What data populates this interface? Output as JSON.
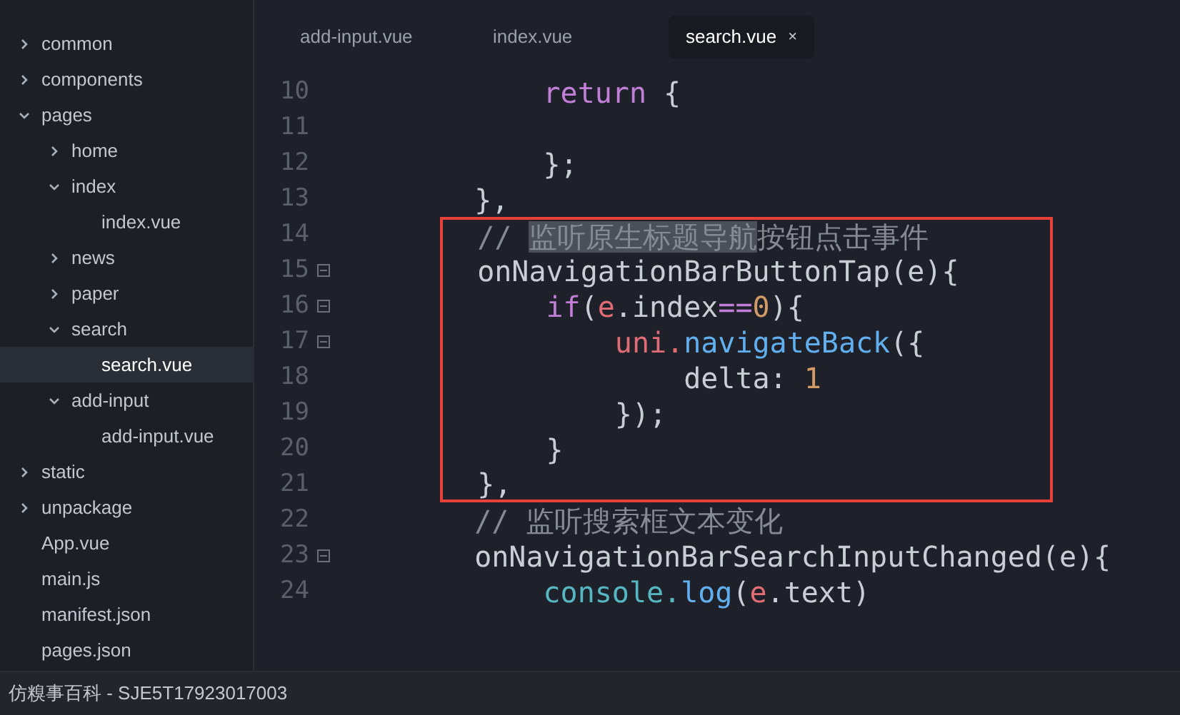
{
  "sidebar": {
    "tree": [
      {
        "label": "common",
        "kind": "folder",
        "expanded": false
      },
      {
        "label": "components",
        "kind": "folder",
        "expanded": false
      },
      {
        "label": "pages",
        "kind": "folder",
        "expanded": true,
        "children": [
          {
            "label": "home",
            "kind": "folder",
            "expanded": false
          },
          {
            "label": "index",
            "kind": "folder",
            "expanded": true,
            "children": [
              {
                "label": "index.vue",
                "kind": "file",
                "selected": false
              }
            ]
          },
          {
            "label": "news",
            "kind": "folder",
            "expanded": false
          },
          {
            "label": "paper",
            "kind": "folder",
            "expanded": false
          },
          {
            "label": "search",
            "kind": "folder",
            "expanded": true,
            "children": [
              {
                "label": "search.vue",
                "kind": "file",
                "selected": true
              }
            ]
          },
          {
            "label": "add-input",
            "kind": "folder",
            "expanded": true,
            "children": [
              {
                "label": "add-input.vue",
                "kind": "file",
                "selected": false
              }
            ]
          }
        ]
      },
      {
        "label": "static",
        "kind": "folder",
        "expanded": false
      },
      {
        "label": "unpackage",
        "kind": "folder",
        "expanded": false
      },
      {
        "label": "App.vue",
        "kind": "file",
        "selected": false
      },
      {
        "label": "main.js",
        "kind": "file",
        "selected": false
      },
      {
        "label": "manifest.json",
        "kind": "file",
        "selected": false
      },
      {
        "label": "pages.json",
        "kind": "file",
        "selected": false
      }
    ]
  },
  "tabs": [
    {
      "label": "add-input.vue",
      "selected": false
    },
    {
      "label": "index.vue",
      "selected": false
    },
    {
      "label": "search.vue",
      "selected": true,
      "close": "×"
    }
  ],
  "editor": {
    "lines": [
      {
        "number": "10",
        "foldable": false,
        "boxed": false,
        "tokens": [
          {
            "text": "      return",
            "kind": "keyword"
          },
          {
            "text": " {",
            "kind": "plain"
          }
        ]
      },
      {
        "number": "11",
        "foldable": false
      },
      {
        "number": "12",
        "foldable": false,
        "boxed": false,
        "tokens": [
          {
            "text": "      };",
            "kind": "plain"
          }
        ]
      },
      {
        "number": "13",
        "foldable": false,
        "boxed": false,
        "tokens": [
          {
            "text": "  },",
            "kind": "plain"
          }
        ]
      },
      {
        "number": "14",
        "foldable": false,
        "boxed": true,
        "tokens": [
          {
            "text": "  // ",
            "kind": "comment"
          },
          {
            "text": "监听原生标题导航",
            "kind": "comment",
            "selected": true
          },
          {
            "text": "按钮点击事件",
            "kind": "comment"
          }
        ]
      },
      {
        "number": "15",
        "foldable": true,
        "boxed": true,
        "tokens": [
          {
            "text": "  onNavigationBarButtonTap(e){",
            "kind": "plain"
          }
        ]
      },
      {
        "number": "16",
        "foldable": true,
        "boxed": true,
        "tokens": [
          {
            "text": "      if",
            "kind": "keyword"
          },
          {
            "text": "(",
            "kind": "plain"
          },
          {
            "text": "e",
            "kind": "variable"
          },
          {
            "text": ".index",
            "kind": "plain"
          },
          {
            "text": "==",
            "kind": "keyword"
          },
          {
            "text": "0",
            "kind": "number"
          },
          {
            "text": "){",
            "kind": "plain"
          }
        ]
      },
      {
        "number": "17",
        "foldable": true,
        "boxed": true,
        "tokens": [
          {
            "text": "          uni.",
            "kind": "variable"
          },
          {
            "text": "navigateBack",
            "kind": "function"
          },
          {
            "text": "({",
            "kind": "plain"
          }
        ]
      },
      {
        "number": "18",
        "foldable": false,
        "boxed": true,
        "tokens": [
          {
            "text": "              delta: ",
            "kind": "plain"
          },
          {
            "text": "1",
            "kind": "number"
          }
        ]
      },
      {
        "number": "19",
        "foldable": false,
        "boxed": true,
        "tokens": [
          {
            "text": "          });",
            "kind": "plain"
          }
        ]
      },
      {
        "number": "20",
        "foldable": false,
        "boxed": true,
        "tokens": [
          {
            "text": "      }",
            "kind": "plain"
          }
        ]
      },
      {
        "number": "21",
        "foldable": false,
        "boxed": true,
        "tokens": [
          {
            "text": "  },",
            "kind": "plain"
          }
        ]
      },
      {
        "number": "22",
        "foldable": false,
        "boxed": false,
        "tokens": [
          {
            "text": "  // 监听搜索框文本变化",
            "kind": "comment"
          }
        ]
      },
      {
        "number": "23",
        "foldable": true,
        "boxed": false,
        "tokens": [
          {
            "text": "  onNavigationBarSearchInputChanged(e){",
            "kind": "plain"
          }
        ]
      },
      {
        "number": "24",
        "foldable": false,
        "boxed": false,
        "tokens": [
          {
            "text": "      console.",
            "kind": "builtin"
          },
          {
            "text": "log",
            "kind": "function"
          },
          {
            "text": "(",
            "kind": "plain"
          },
          {
            "text": "e",
            "kind": "variable"
          },
          {
            "text": ".text)",
            "kind": "plain"
          }
        ]
      }
    ]
  },
  "status_bar": {
    "text": "仿糗事百科 - SJE5T17923017003"
  }
}
